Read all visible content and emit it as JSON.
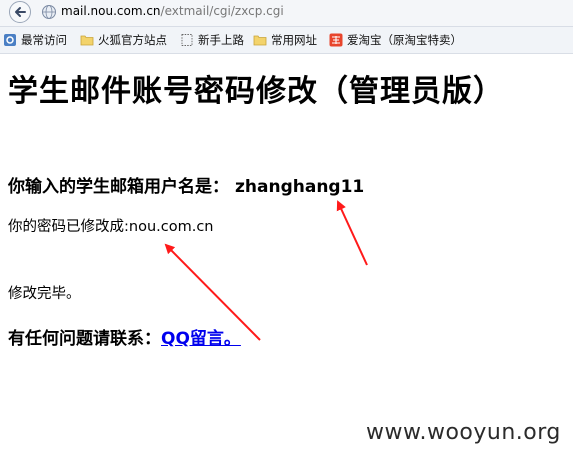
{
  "browser": {
    "url_host": "mail.nou.com.cn",
    "url_path": "/extmail/cgi/zxcp.cgi",
    "bookmarks": [
      {
        "label": "最常访问",
        "icon": "bookmark-gear-icon"
      },
      {
        "label": "火狐官方站点",
        "icon": "folder-icon"
      },
      {
        "label": "新手上路",
        "icon": "dotted-page-icon"
      },
      {
        "label": "常用网址",
        "icon": "folder-icon"
      },
      {
        "label": "爱淘宝（原淘宝特卖）",
        "icon": "taobao-icon"
      }
    ]
  },
  "page": {
    "title": "学生邮件账号密码修改（管理员版）",
    "username_label": "你输入的学生邮箱用户名是：",
    "username_value": "zhanghang11",
    "password_line": "你的密码已修改成:nou.com.cn",
    "done_text": "修改完毕。",
    "contact_label": "有任何问题请联系：",
    "contact_link": "QQ留言。"
  },
  "watermark": "www.wooyun.org",
  "colors": {
    "arrow": "#ff1a1a",
    "link": "#0000ee"
  }
}
